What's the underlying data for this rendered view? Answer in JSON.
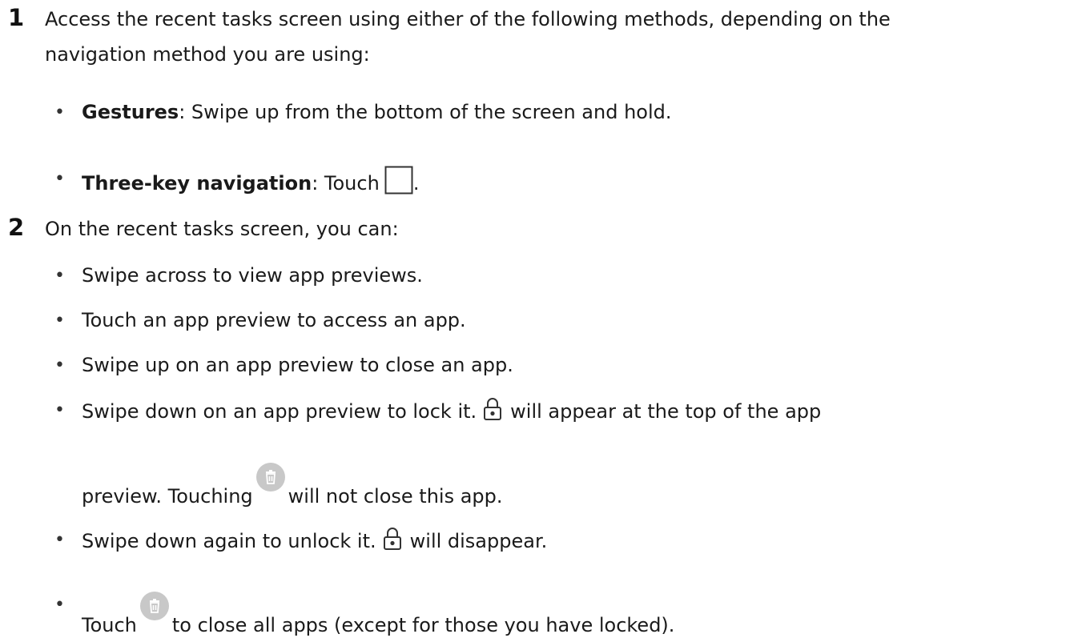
{
  "steps": [
    {
      "number": "1",
      "intro_line1": "Access the recent tasks screen using either of the following methods, depending on the",
      "intro_line2": "navigation method you are using:",
      "bullets": [
        {
          "bold": "Gestures",
          "text": ": Swipe up from the bottom of the screen and hold."
        },
        {
          "bold": "Three-key navigation",
          "text": ": Touch",
          "suffix": "."
        }
      ]
    },
    {
      "number": "2",
      "intro_line1": "On the recent tasks screen, you can:",
      "bullets": [
        {
          "text": "Swipe across to view app previews."
        },
        {
          "text": "Touch an app preview to access an app."
        },
        {
          "text": "Swipe up on an app preview to close an app."
        },
        {
          "text_before": "Swipe down on an app preview to lock it.",
          "text_after": "will appear at the top of the app",
          "text_line2_before": "preview. Touching",
          "text_line2_after": "will not close this app."
        },
        {
          "text_before": "Swipe down again to unlock it.",
          "text_after": "will disappear."
        },
        {
          "text_before": "Touch",
          "text_after": "to close all apps (except for those you have locked)."
        }
      ]
    }
  ],
  "bullet_char": "•",
  "icons": {
    "recent_key": "square-recent-tasks-icon",
    "lock": "lock-icon",
    "trash": "trash-delete-icon"
  },
  "colors": {
    "text": "#1a1a1a",
    "trash_bg": "#c8c8c8",
    "icon_stroke": "#333333"
  }
}
